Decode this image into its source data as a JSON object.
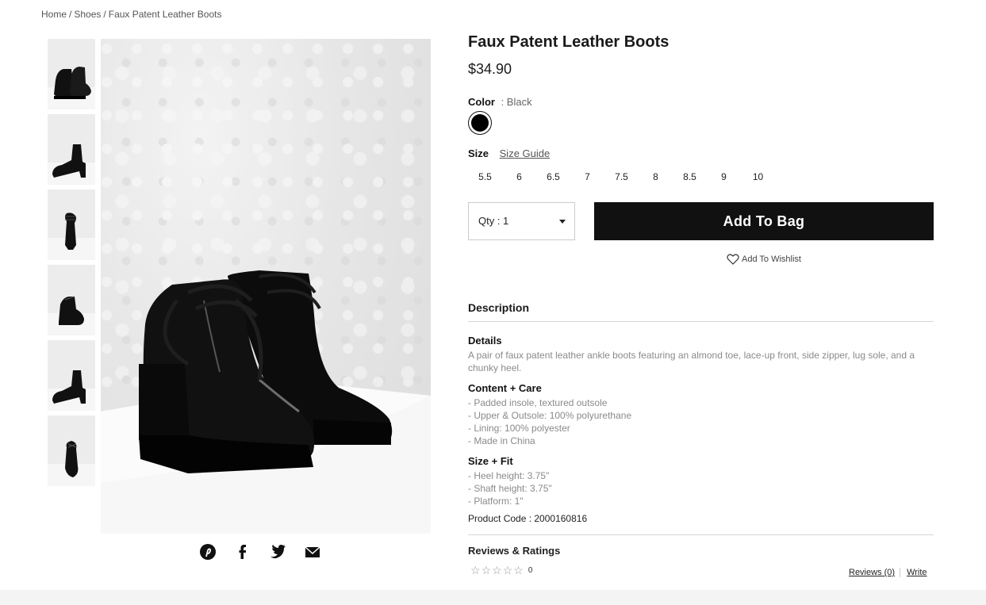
{
  "breadcrumb": {
    "items": [
      "Home",
      "Shoes",
      "Faux Patent Leather Boots"
    ],
    "separator": "/"
  },
  "product": {
    "title": "Faux Patent Leather Boots",
    "price": "$34.90",
    "color_label": "Color",
    "color_value": ": Black",
    "swatch_color": "#000000",
    "size_label": "Size",
    "size_guide": "Size Guide",
    "sizes": [
      "5.5",
      "6",
      "6.5",
      "7",
      "7.5",
      "8",
      "8.5",
      "9",
      "10"
    ],
    "qty": "Qty : 1",
    "add_to_bag": "Add To Bag",
    "wishlist": "Add To Wishlist"
  },
  "description": {
    "heading": "Description",
    "details_title": "Details",
    "details_text": "A pair of faux patent leather ankle boots featuring an almond toe, lace-up front, side zipper, lug sole, and a chunky heel.",
    "content_title": "Content + Care",
    "content_items": [
      "- Padded insole, textured outsole",
      "- Upper & Outsole: 100% polyurethane",
      "- Lining: 100% polyester",
      "- Made in China"
    ],
    "fit_title": "Size + Fit",
    "fit_items": [
      "- Heel height: 3.75\"",
      "- Shaft height: 3.75\"",
      "- Platform: 1\""
    ],
    "product_code": "Product Code : 2000160816"
  },
  "reviews": {
    "heading": "Reviews & Ratings",
    "rating_count": "0",
    "reviews_link": "Reviews (0)",
    "write_link": "Write"
  },
  "share_icons": [
    "pinterest-icon",
    "facebook-icon",
    "twitter-icon",
    "email-icon"
  ],
  "colors": {
    "button_bg": "#111111",
    "muted_text": "#8a8a8a",
    "rule": "#d6d6d6"
  }
}
